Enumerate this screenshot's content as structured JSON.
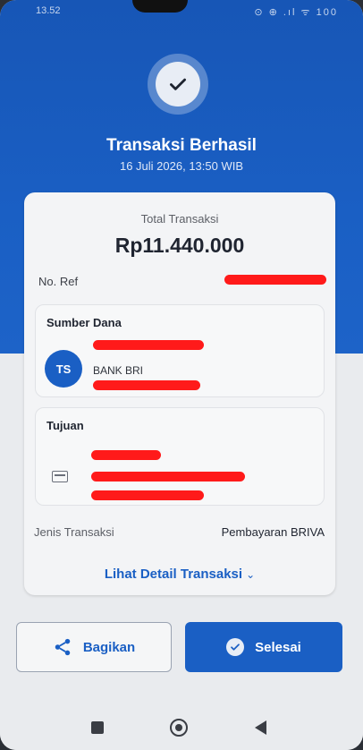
{
  "status_bar": {
    "time": "13.52",
    "icons": "⊙ ⊕ .ıl ᯤ",
    "battery": "100"
  },
  "header": {
    "title": "Transaksi Berhasil",
    "datetime": "16 Juli 2026, 13:50 WIB"
  },
  "summary": {
    "total_label": "Total Transaksi",
    "total_amount": "Rp11.440.000",
    "ref_label": "No. Ref"
  },
  "source": {
    "title": "Sumber Dana",
    "avatar_initials": "TS",
    "bank": "BANK BRI"
  },
  "destination": {
    "title": "Tujuan",
    "icon": "credit-card-icon"
  },
  "transaction_type": {
    "label": "Jenis Transaksi",
    "value": "Pembayaran BRIVA"
  },
  "detail_link": {
    "label": "Lihat Detail Transaksi",
    "chevron": "⌄"
  },
  "buttons": {
    "share_label": "Bagikan",
    "done_label": "Selesai"
  },
  "colors": {
    "primary": "#1a5fc4",
    "redaction": "#ff1a1a"
  }
}
